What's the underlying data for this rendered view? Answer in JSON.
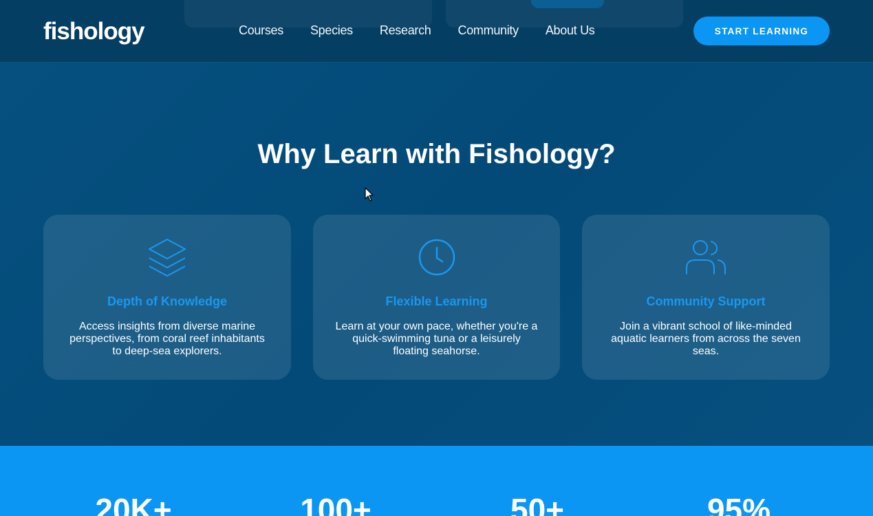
{
  "header": {
    "logo": "fishology",
    "nav": [
      "Courses",
      "Species",
      "Research",
      "Community",
      "About Us"
    ],
    "cta_label": "START LEARNING"
  },
  "features": {
    "title": "Why Learn with Fishology?",
    "cards": [
      {
        "icon": "layers-icon",
        "title": "Depth of Knowledge",
        "text": "Access insights from diverse marine perspectives, from coral reef inhabitants to deep-sea explorers."
      },
      {
        "icon": "clock-icon",
        "title": "Flexible Learning",
        "text": "Learn at your own pace, whether you're a quick-swimming tuna or a leisurely floating seahorse."
      },
      {
        "icon": "users-icon",
        "title": "Community Support",
        "text": "Join a vibrant school of like-minded aquatic learners from across the seven seas."
      }
    ]
  },
  "stats": [
    "20K+",
    "100+",
    "50+",
    "95%"
  ],
  "colors": {
    "accent": "#0a96f2",
    "header_bg": "#053e63",
    "section_bg": "#034b79"
  }
}
